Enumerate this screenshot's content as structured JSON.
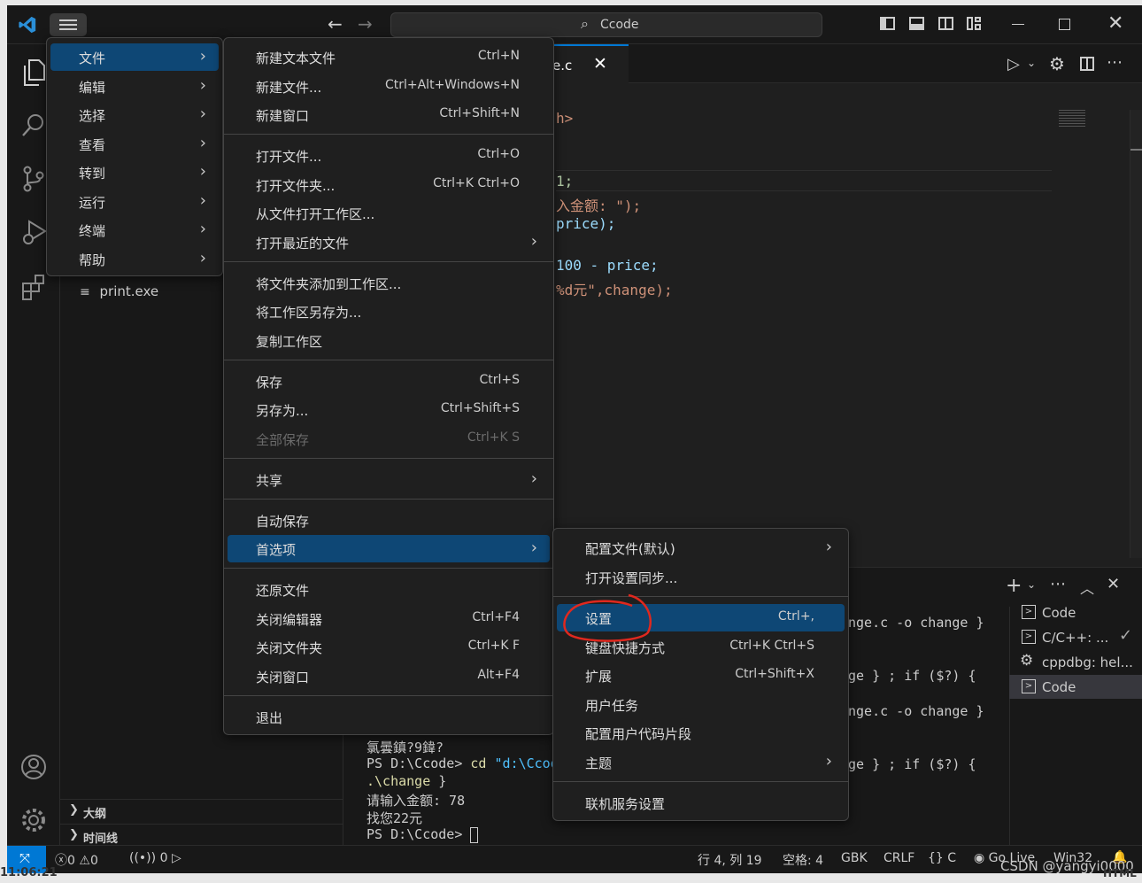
{
  "titlebar": {
    "search_text": "Ccode",
    "back_icon": "arrow-left-icon",
    "forward_icon": "arrow-right-icon",
    "layout_icons": [
      "toggle-primary-sidebar-icon",
      "toggle-panel-icon",
      "toggle-secondary-sidebar-icon",
      "customize-layout-icon"
    ],
    "window_controls": [
      "minimize-icon",
      "maximize-icon",
      "close-icon"
    ]
  },
  "menu_main": {
    "items": [
      {
        "label": "文件",
        "selected": true
      },
      {
        "label": "编辑"
      },
      {
        "label": "选择"
      },
      {
        "label": "查看"
      },
      {
        "label": "转到"
      },
      {
        "label": "运行"
      },
      {
        "label": "终端"
      },
      {
        "label": "帮助"
      }
    ]
  },
  "file_menu": {
    "items": [
      {
        "label": "新建文本文件",
        "key": "Ctrl+N"
      },
      {
        "label": "新建文件...",
        "key": "Ctrl+Alt+Windows+N"
      },
      {
        "label": "新建窗口",
        "key": "Ctrl+Shift+N"
      },
      {
        "label": "打开文件...",
        "key": "Ctrl+O"
      },
      {
        "label": "打开文件夹...",
        "key": "Ctrl+K Ctrl+O"
      },
      {
        "label": "从文件打开工作区...",
        "key": ""
      },
      {
        "label": "打开最近的文件",
        "key": ""
      },
      {
        "label": "将文件夹添加到工作区...",
        "key": ""
      },
      {
        "label": "将工作区另存为...",
        "key": ""
      },
      {
        "label": "复制工作区",
        "key": ""
      },
      {
        "label": "保存",
        "key": "Ctrl+S"
      },
      {
        "label": "另存为...",
        "key": "Ctrl+Shift+S"
      },
      {
        "label": "全部保存",
        "key": "Ctrl+K S"
      },
      {
        "label": "共享",
        "key": ""
      },
      {
        "label": "自动保存",
        "key": ""
      },
      {
        "label": "首选项",
        "key": ""
      },
      {
        "label": "还原文件",
        "key": ""
      },
      {
        "label": "关闭编辑器",
        "key": "Ctrl+F4"
      },
      {
        "label": "关闭文件夹",
        "key": "Ctrl+K F"
      },
      {
        "label": "关闭窗口",
        "key": "Alt+F4"
      },
      {
        "label": "退出",
        "key": ""
      }
    ]
  },
  "prefs_menu": {
    "items": [
      {
        "label": "配置文件(默认)",
        "key": ""
      },
      {
        "label": "打开设置同步...",
        "key": ""
      },
      {
        "label": "设置",
        "key": "Ctrl+,"
      },
      {
        "label": "键盘快捷方式",
        "key": "Ctrl+K Ctrl+S"
      },
      {
        "label": "扩展",
        "key": "Ctrl+Shift+X"
      },
      {
        "label": "用户任务",
        "key": ""
      },
      {
        "label": "配置用户代码片段",
        "key": ""
      },
      {
        "label": "主题",
        "key": ""
      },
      {
        "label": "联机服务设置",
        "key": ""
      }
    ]
  },
  "sidebar": {
    "file": "print.exe",
    "outline": "大纲",
    "timeline": "时间线"
  },
  "editor": {
    "tab_label": "e.c",
    "code": [
      "h>",
      "1;",
      "入金额: \");",
      "price);",
      "100 - price;",
      "%d元\",change);"
    ]
  },
  "terminal": {
    "lines_right": [
      "nge.c -o change }",
      "ge } ; if ($?) {",
      "nge.c -o change }",
      "ge } ; if ($?) {"
    ],
    "garbled": "氯曇鎮?9鍏?",
    "ps_cd": "PS D:\\Ccode> ",
    "cd_cmd": "cd",
    "cd_path": "\"d:\\Ccod",
    "run": ".\\change",
    "run_end": " }",
    "prompt_input": "请输入金额: 78",
    "output": "找您22元",
    "ps_last": "PS D:\\Ccode> ",
    "tabs": [
      "Code",
      "C/C++: ...",
      "cppdbg: hel...",
      "Code"
    ]
  },
  "statusbar": {
    "errors": "0",
    "warnings": "0",
    "ports": "0",
    "position": "行 4, 列 19",
    "spaces": "空格: 4",
    "encoding": "GBK",
    "eol": "CRLF",
    "language": "C",
    "golive": "Go Live",
    "platform": "Win32",
    "watermark": "CSDN @yangyi0000"
  },
  "taskbar": {
    "clock": "11:06:21",
    "right": "HTML"
  }
}
